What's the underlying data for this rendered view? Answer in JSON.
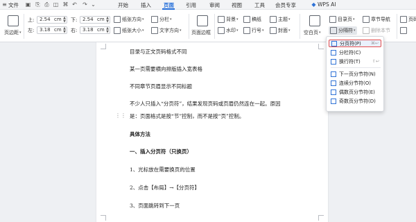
{
  "menubar": {
    "file": "文件",
    "tabs": [
      "开始",
      "插入",
      "页面",
      "引用",
      "审阅",
      "视图",
      "工具",
      "会员专享",
      "WPS AI"
    ],
    "active_tab": "页面",
    "accent": "#1f6bd9"
  },
  "ribbon": {
    "margins_label": "页边距",
    "top_label": "上:",
    "top_value": "2.54",
    "bottom_label": "下:",
    "bottom_value": "2.54",
    "left_label": "左:",
    "left_value": "3.18",
    "right_label": "右:",
    "right_value": "3.18",
    "unit": "cm",
    "orientation": "纸张方向",
    "size": "纸张大小",
    "columns": "分栏",
    "text_direction": "文字方向",
    "page_border": "页面边框",
    "background": "背景",
    "watermark": "水印",
    "manuscript": "稿纸",
    "line_numbers": "行号",
    "theme": "主题",
    "cover": "封面",
    "blank_page": "空白页",
    "toc_page": "目录页",
    "breaks": "分隔符",
    "section_nav": "章节导航",
    "delete_section": "删除本节",
    "page_right": "页码"
  },
  "document": {
    "lines": [
      "目录与正文页码格式不同",
      "某一页需要横向排版插入宽表格",
      "不同章节页眉显示不同标题",
      "不少人只插入“分页符”，结果发现页码或页眉仍然连在一起。原因",
      "是：页面格式是按“节”控制，而不是按“页”控制。",
      "具体方法",
      "一、插入分页符（只换页）",
      "1、光标放在需要换页的位置",
      "2、点击【布局】→【分页符】",
      "3、页面跳转到下一页"
    ]
  },
  "dropdown": {
    "items": [
      {
        "label": "分页符(P)",
        "shortcut": "⌘↩"
      },
      {
        "label": "分栏符(C)",
        "shortcut": ""
      },
      {
        "label": "换行符(T)",
        "shortcut": "⇧↩"
      },
      {
        "label": "下一页分节符(N)",
        "shortcut": ""
      },
      {
        "label": "连续分节符(O)",
        "shortcut": ""
      },
      {
        "label": "偶数页分节符(E)",
        "shortcut": ""
      },
      {
        "label": "奇数页分节符(D)",
        "shortcut": ""
      }
    ],
    "highlight_color": "#e34b4b"
  }
}
